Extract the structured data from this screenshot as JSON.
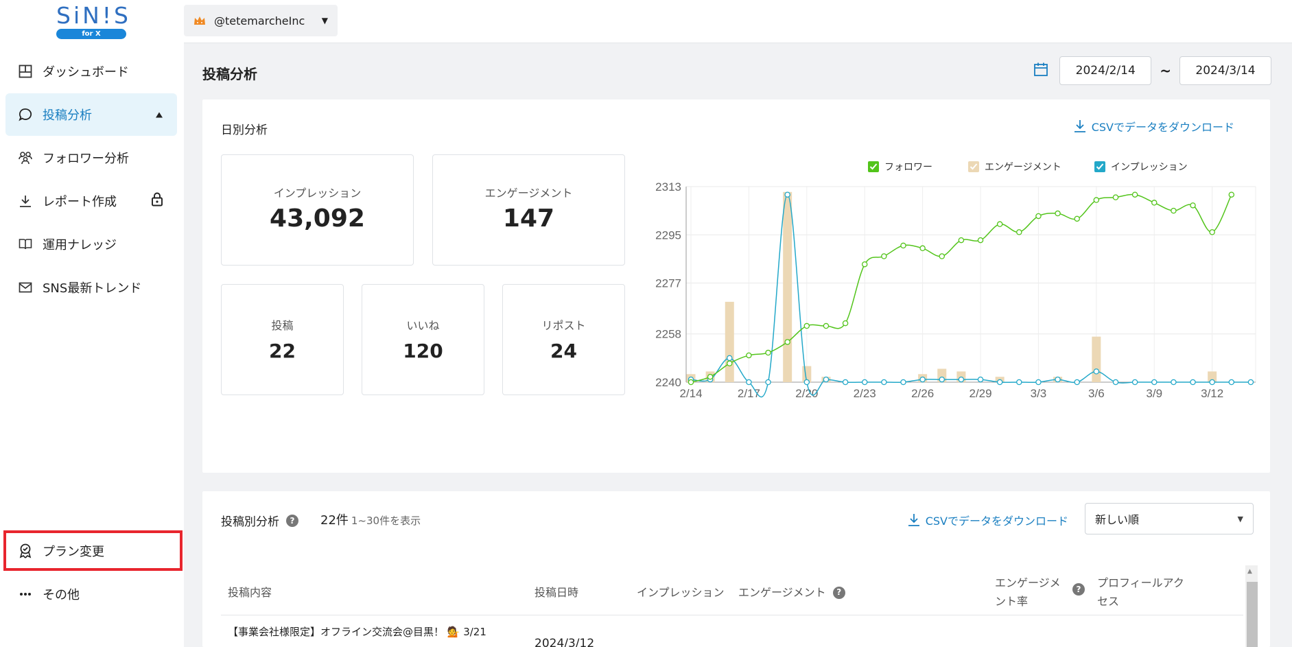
{
  "logo": {
    "text": "SiN!S",
    "sub": "for X"
  },
  "account": {
    "handle": "@tetemarcheInc"
  },
  "sidebar": {
    "items": [
      {
        "label": "ダッシュボード"
      },
      {
        "label": "投稿分析"
      },
      {
        "label": "フォロワー分析"
      },
      {
        "label": "レポート作成"
      },
      {
        "label": "運用ナレッジ"
      },
      {
        "label": "SNS最新トレンド"
      }
    ],
    "bottom": [
      {
        "label": "プラン変更"
      },
      {
        "label": "その他"
      }
    ]
  },
  "page": {
    "title": "投稿分析"
  },
  "date_range": {
    "start": "2024/2/14",
    "separator": "~",
    "end": "2024/3/14"
  },
  "daily": {
    "heading": "日別分析",
    "csv_label": "CSVでデータをダウンロード",
    "cards": {
      "impressions": {
        "label": "インプレッション",
        "value": "43,092"
      },
      "engagement": {
        "label": "エンゲージメント",
        "value": "147"
      },
      "posts": {
        "label": "投稿",
        "value": "22"
      },
      "likes": {
        "label": "いいね",
        "value": "120"
      },
      "reposts": {
        "label": "リポスト",
        "value": "24"
      }
    }
  },
  "chart_data": {
    "type": "line",
    "legend": [
      "フォロワー",
      "エンゲージメント",
      "インプレッション"
    ],
    "legend_position": "top",
    "colors": {
      "followers": "#52c41a",
      "engagement": "#ecd8b5",
      "impressions": "#23a8c9"
    },
    "ylim": [
      2240,
      2313
    ],
    "y_ticks": [
      2240,
      2258,
      2277,
      2295,
      2313
    ],
    "x": [
      "2/14",
      "2/15",
      "2/16",
      "2/17",
      "2/18",
      "2/19",
      "2/20",
      "2/21",
      "2/22",
      "2/23",
      "2/24",
      "2/25",
      "2/26",
      "2/27",
      "2/28",
      "2/29",
      "3/1",
      "3/2",
      "3/3",
      "3/4",
      "3/5",
      "3/6",
      "3/7",
      "3/8",
      "3/9",
      "3/10",
      "3/11",
      "3/12",
      "3/13",
      "3/14"
    ],
    "x_tick_labels": [
      "2/14",
      "2/17",
      "2/20",
      "2/23",
      "2/26",
      "2/29",
      "3/3",
      "3/6",
      "3/9",
      "3/12"
    ],
    "grid": true,
    "series": [
      {
        "name": "フォロワー",
        "kind": "line",
        "values": [
          2240,
          2242,
          2247,
          2250,
          2251,
          2255,
          2261,
          2261,
          2262,
          2284,
          2287,
          2291,
          2290,
          2287,
          2293,
          2293,
          2299,
          2296,
          2302,
          2303,
          2301,
          2308,
          2309,
          2310,
          2307,
          2304,
          2306,
          2296,
          2310
        ]
      },
      {
        "name": "エンゲージメント",
        "kind": "bar",
        "values": [
          2243,
          2244,
          2270,
          2240,
          2240,
          2311,
          2246,
          2242,
          2240,
          2240,
          2240,
          2240,
          2243,
          2245,
          2244,
          2240,
          2242,
          2240,
          2240,
          2242,
          2240,
          2257,
          2240,
          2240,
          2240,
          2240,
          2240,
          2244,
          2240,
          2240
        ]
      },
      {
        "name": "インプレッション",
        "kind": "line",
        "values": [
          2241,
          2241,
          2249,
          2240,
          2240,
          2310,
          2240,
          2241,
          2240,
          2240,
          2240,
          2240,
          2241,
          2241,
          2241,
          2241,
          2240,
          2240,
          2240,
          2241,
          2240,
          2244,
          2240,
          2240,
          2240,
          2240,
          2240,
          2240,
          2240,
          2240
        ]
      }
    ]
  },
  "post_list": {
    "heading": "投稿別分析",
    "count": "22件",
    "range": "1~30件を表示",
    "csv_label": "CSVでデータをダウンロード",
    "sort": "新しい順",
    "columns": [
      {
        "label": "投稿内容"
      },
      {
        "label": "投稿日時"
      },
      {
        "label": "インプレッション"
      },
      {
        "label": "エンゲージメント"
      },
      {
        "label": "エンゲージメ\nント率"
      },
      {
        "label": "プロフィールアク\nセス"
      }
    ],
    "rows": [
      {
        "content": "【事業会社様限定】オフライン交流会@目黒！ 💁 3/21",
        "date": "2024/3/12"
      }
    ]
  }
}
